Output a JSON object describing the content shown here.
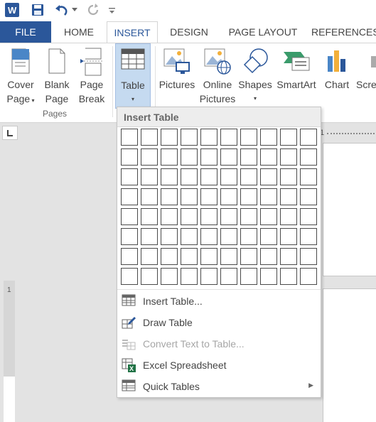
{
  "qat": {
    "word_icon": "word-app-icon",
    "save_icon": "save-icon",
    "undo_icon": "undo-icon",
    "redo_icon": "redo-icon",
    "customize_icon": "customize-qat-icon"
  },
  "tabs": [
    {
      "label": "FILE"
    },
    {
      "label": "HOME"
    },
    {
      "label": "INSERT"
    },
    {
      "label": "DESIGN"
    },
    {
      "label": "PAGE LAYOUT"
    },
    {
      "label": "REFERENCES"
    }
  ],
  "ribbon": {
    "cover_page": {
      "line1": "Cover",
      "line2": "Page"
    },
    "blank_page": {
      "line1": "Blank",
      "line2": "Page"
    },
    "page_break": {
      "line1": "Page",
      "line2": "Break"
    },
    "pages_group": "Pages",
    "table": {
      "line1": "Table"
    },
    "pictures": {
      "line1": "Pictures"
    },
    "online_pictures": {
      "line1": "Online",
      "line2": "Pictures"
    },
    "shapes": {
      "line1": "Shapes"
    },
    "smartart": {
      "line1": "SmartArt"
    },
    "chart": {
      "line1": "Chart"
    },
    "screenshot": {
      "line1": "Scre"
    }
  },
  "ruler": {
    "h_mark": "1",
    "v_mark": "1"
  },
  "dropdown": {
    "title": "Insert Table",
    "grid_cols": 10,
    "grid_rows": 8,
    "items": [
      {
        "label": "Insert Table...",
        "enabled": true,
        "icon": "insert-table-icon"
      },
      {
        "label": "Draw Table",
        "enabled": true,
        "icon": "draw-table-icon"
      },
      {
        "label": "Convert Text to Table...",
        "enabled": false,
        "icon": "convert-text-to-table-icon"
      },
      {
        "label": "Excel Spreadsheet",
        "enabled": true,
        "icon": "excel-spreadsheet-icon"
      },
      {
        "label": "Quick Tables",
        "enabled": true,
        "icon": "quick-tables-icon",
        "submenu": true
      }
    ]
  },
  "colors": {
    "accent": "#2b579a",
    "active_button": "#c5daf0",
    "excel_green": "#217346"
  }
}
